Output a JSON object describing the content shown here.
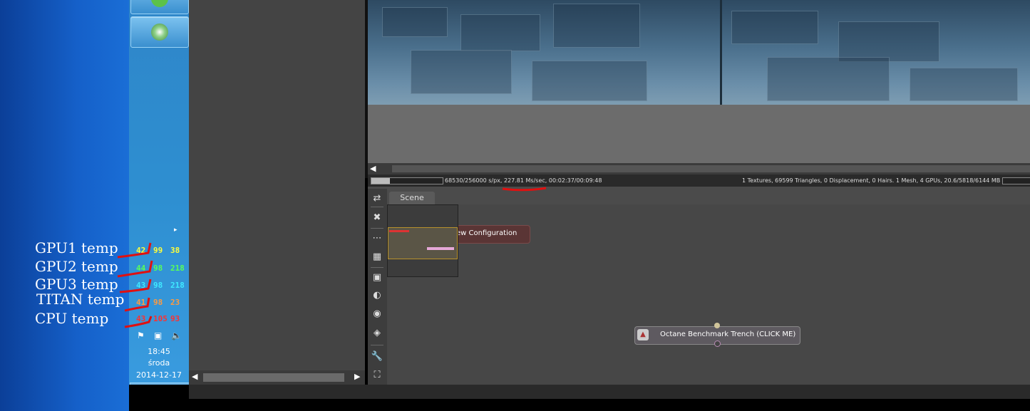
{
  "taskbar": {
    "tray_expand_glyph": "▸",
    "temps": [
      {
        "values": [
          "42",
          "99",
          "38"
        ],
        "colors": [
          "#ffff3a",
          "#ffff3a",
          "#ffff3a"
        ]
      },
      {
        "values": [
          "44",
          "98",
          "218"
        ],
        "colors": [
          "#58ff58",
          "#58ff58",
          "#58ff58"
        ]
      },
      {
        "values": [
          "43",
          "98",
          "218"
        ],
        "colors": [
          "#3fe8ff",
          "#3fe8ff",
          "#3fe8ff"
        ]
      },
      {
        "values": [
          "41",
          "98",
          "23"
        ],
        "colors": [
          "#ff9a40",
          "#ff9a40",
          "#ff9a40"
        ]
      },
      {
        "values": [
          "43",
          "105",
          "93"
        ],
        "colors": [
          "#ff3030",
          "#ff3030",
          "#ff3030"
        ]
      }
    ],
    "tray_icons": [
      "flag-icon",
      "network-icon",
      "volume-icon"
    ],
    "clock": {
      "time": "18:45",
      "day": "środa",
      "date": "2014-12-17"
    },
    "pinned_apps": [
      "utorrent-icon",
      "windows-update-icon"
    ]
  },
  "annotations": [
    "GPU1 temp",
    "GPU2 temp",
    "GPU3 temp",
    "TITAN temp",
    "CPU temp"
  ],
  "octane": {
    "status_left": "68530/256000 s/px, 227.81 Ms/sec, 00:02:37/00:09:48",
    "status_right": "1 Textures, 69599 Triangles, 0 Displacement, 0 Hairs. 1 Mesh, 4 GPUs, 20.6/5818/6144 MB",
    "render_progress": 0.27,
    "scene_tab": "Scene",
    "config_node_label": "ew Configuration",
    "benchmark_node_label": "Octane Benchmark Trench (CLICK ME)",
    "toolbar_icons": [
      "link-icon",
      "delete-node-icon",
      "graph-expand-icon",
      "graph-fit-icon",
      "render-icon",
      "material-icon",
      "texture-icon",
      "environment-icon",
      "settings-wrench-icon",
      "fullscreen-icon"
    ],
    "scroll_left_glyph": "◀",
    "scroll_right_glyph": "▶"
  },
  "colors": {
    "annotation_red": "#e01010"
  }
}
